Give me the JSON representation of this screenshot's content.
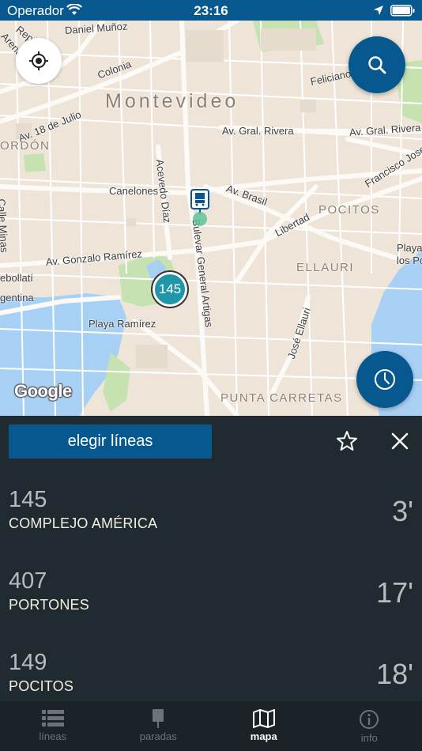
{
  "status": {
    "carrier": "Operador",
    "time": "23:16"
  },
  "map": {
    "labels": {
      "city": "Montevideo",
      "cordon": "ORDÓN",
      "pocitos": "POCITOS",
      "ellauri": "ELLAURI",
      "punta_carretas": "PUNTA CARRETAS",
      "republica": "Republica",
      "arenal": "Arenal G",
      "daniel_munoz": "Daniel Muñoz",
      "colonia": "Colonia",
      "av_18_julio": "Av. 18 de Julio",
      "feliciano": "Feliciano",
      "gral_rivera_1": "Av. Gral. Rivera",
      "gral_rivera_2": "Av. Gral. Rivera",
      "francisco_jose": "Francisco Jose",
      "acevedo_diaz": "Acevedo Díaz",
      "canelones": "Canelones",
      "av_brasil": "Av. Brasil",
      "libertad": "Libertad",
      "calle_minas": "Calle Minas",
      "bulevar_artigas": "Bulevar General Artigas",
      "gonzalo_ramirez": "Av. Gonzalo Ramírez",
      "playa_los_po": "Playa\nlos Po",
      "rebollati": "ebollatí",
      "argentina": "gentina",
      "playa_ramirez": "Playa Ramírez",
      "jose_ellauri": "José Ellauri"
    },
    "bus_marker": "145",
    "google": "Google"
  },
  "panel": {
    "choose_lines": "elegir líneas",
    "arrivals": [
      {
        "line": "145",
        "destination": "COMPLEJO AMÉRICA",
        "eta": "3'"
      },
      {
        "line": "407",
        "destination": "PORTONES",
        "eta": "17'"
      },
      {
        "line": "149",
        "destination": "POCITOS",
        "eta": "18'"
      }
    ]
  },
  "tabs": [
    {
      "label": "líneas",
      "icon": "list-icon",
      "active": false
    },
    {
      "label": "paradas",
      "icon": "bus-stop-icon",
      "active": false
    },
    {
      "label": "mapa",
      "icon": "map-icon",
      "active": true
    },
    {
      "label": "info",
      "icon": "info-icon",
      "active": false
    }
  ],
  "colors": {
    "accent": "#06588f",
    "panel_bg": "#202a31",
    "marker": "#2196a8",
    "water": "#a8d0f5",
    "park": "#c5e2b0"
  }
}
